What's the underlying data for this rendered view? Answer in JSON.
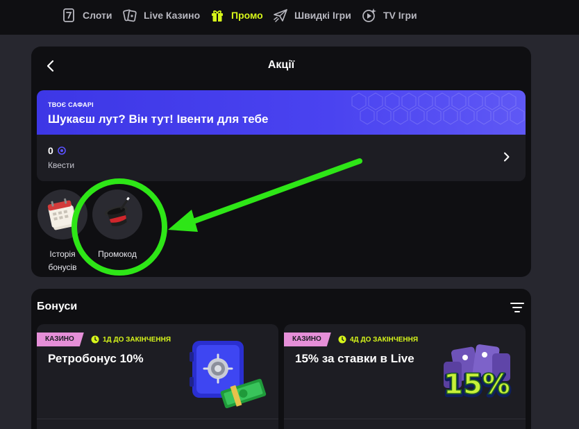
{
  "nav": {
    "items": [
      {
        "label": "Слоти",
        "icon": "slot-seven-icon",
        "active": false
      },
      {
        "label": "Live Казино",
        "icon": "playing-cards-icon",
        "active": false
      },
      {
        "label": "Промо",
        "icon": "gift-icon",
        "active": true
      },
      {
        "label": "Швидкі Ігри",
        "icon": "paper-plane-icon",
        "active": false
      },
      {
        "label": "TV Ігри",
        "icon": "tv-games-icon",
        "active": false
      }
    ]
  },
  "promotions": {
    "title": "Акції",
    "safari": {
      "kicker": "ТВОЄ САФАРІ",
      "heading": "Шукаєш лут? Він тут! Івенти для тебе",
      "quest_count": "0",
      "quest_label": "Квести"
    },
    "tiles": [
      {
        "label_line1": "Історія",
        "label_line2": "бонусів",
        "icon": "calendar-icon"
      },
      {
        "label_line1": "Промокод",
        "label_line2": "",
        "icon": "magic-hat-icon"
      }
    ]
  },
  "bonuses": {
    "title": "Бонуси",
    "cards": [
      {
        "tag": "КАЗИНО",
        "timer": "1Д ДО ЗАКІНЧЕННЯ",
        "title": "Ретробонус 10%",
        "art": "safe-with-cash-icon"
      },
      {
        "tag": "КАЗИНО",
        "timer": "4Д ДО ЗАКІНЧЕННЯ",
        "title": "15% за ставки в Live",
        "art": "fifteen-percent-cards-icon",
        "art_text": "15%"
      }
    ]
  },
  "colors": {
    "accent": "#d6f51a",
    "banner": "#4a43f0",
    "tag": "#e58fd8",
    "annotation": "#2ee617",
    "panel": "#0f0f12",
    "background": "#27272f"
  }
}
